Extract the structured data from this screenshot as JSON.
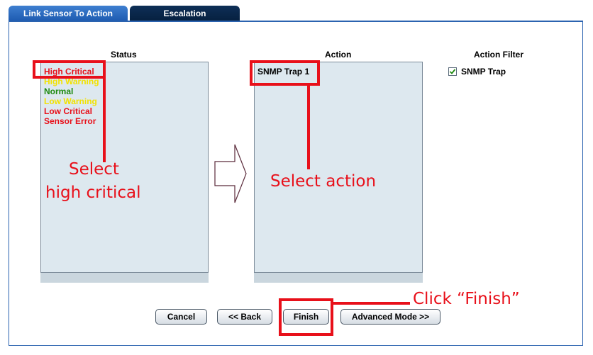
{
  "tabs": [
    {
      "label": "Link Sensor To Action",
      "active": true
    },
    {
      "label": "Escalation",
      "active": false
    }
  ],
  "status": {
    "header": "Status",
    "items": [
      {
        "label": "High Critical",
        "color": "#e8101a"
      },
      {
        "label": "High Warning",
        "color": "#f2e200"
      },
      {
        "label": "Normal",
        "color": "#1e8a10"
      },
      {
        "label": "Low Warning",
        "color": "#f2e200"
      },
      {
        "label": "Low Critical",
        "color": "#e8101a"
      },
      {
        "label": "Sensor Error",
        "color": "#e8101a"
      }
    ]
  },
  "action": {
    "header": "Action",
    "items": [
      {
        "label": "SNMP Trap 1"
      }
    ]
  },
  "action_filter": {
    "header": "Action Filter",
    "options": [
      {
        "label": "SNMP Trap",
        "checked": true
      }
    ]
  },
  "buttons": {
    "cancel": "Cancel",
    "back": "<< Back",
    "finish": "Finish",
    "advanced": "Advanced Mode >>"
  },
  "annotations": {
    "select_high_critical_line1": "Select",
    "select_high_critical_line2": "high critical",
    "select_action": "Select action",
    "click_finish": "Click “Finish”"
  },
  "colors": {
    "tab_active": "#2d6fc2",
    "tab_inactive": "#0a2747",
    "panel_border": "#2b63b0",
    "listbox_bg": "#dde8ef",
    "highlight": "#e8101a"
  }
}
